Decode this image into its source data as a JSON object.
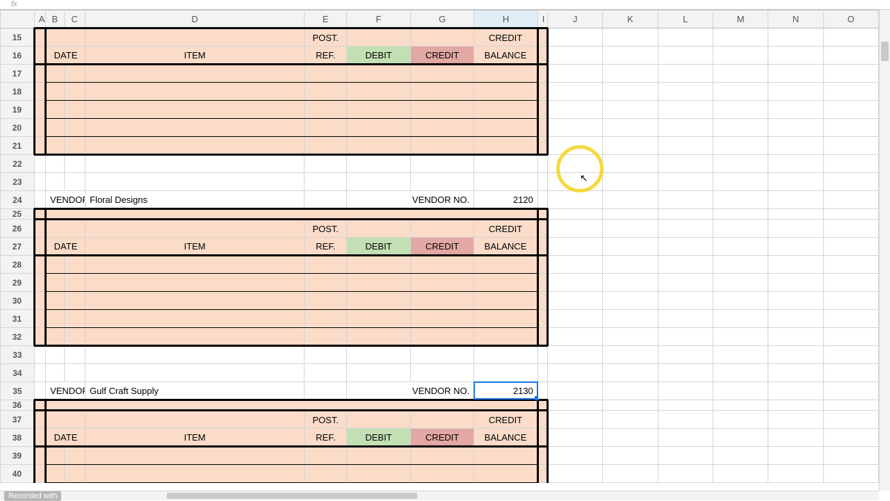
{
  "fx_label": "fx",
  "columns": [
    "",
    "A",
    "B",
    "C",
    "D",
    "E",
    "F",
    "G",
    "H",
    "I",
    "J",
    "K",
    "L",
    "M",
    "N",
    "O"
  ],
  "selected_col": "H",
  "rows_visible": [
    15,
    16,
    17,
    18,
    19,
    20,
    21,
    22,
    23,
    24,
    25,
    26,
    27,
    28,
    29,
    30,
    31,
    32,
    33,
    34,
    35,
    36,
    37,
    38,
    39,
    40
  ],
  "header": {
    "date": "DATE",
    "item": "ITEM",
    "post_ref_top": "POST.",
    "post_ref_bot": "REF.",
    "debit": "DEBIT",
    "credit": "CREDIT",
    "credit_balance_top": "CREDIT",
    "credit_balance_bot": "BALANCE"
  },
  "vendor_label": "VENDOR",
  "vendor_no_label": "VENDOR NO.",
  "vendors": [
    {
      "name": "Floral Designs",
      "no": "2120"
    },
    {
      "name": "Gulf Craft Supply",
      "no": "2130"
    }
  ],
  "watermark": "Recorded with"
}
